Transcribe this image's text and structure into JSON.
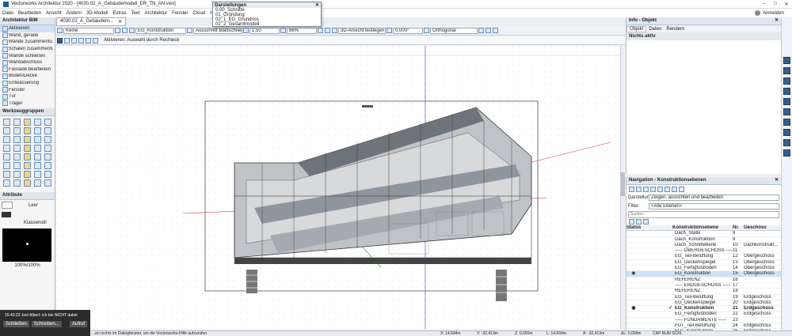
{
  "window": {
    "title": "Vectorworks Architektur 2020 - [4030.02_A_Gebäudemodell_ER_TN_AN.vwx]",
    "controls": [
      "–",
      "□",
      "✕"
    ],
    "login": "Anmelden"
  },
  "menu": [
    "Datei",
    "Bearbeiten",
    "Ansicht",
    "Ändern",
    "3D-Modell",
    "Extras",
    "Text",
    "Architektur",
    "Fenster",
    "Cloud",
    "Hilfe"
  ],
  "darstellungen": {
    "title": "Darstellungen",
    "items": [
      "0.00_Schnitte",
      "01_Gründung",
      "02_1_EG_Grundriss",
      "02_2_Gesamtmodell"
    ]
  },
  "doc_tab": "4030.02_A_Gebäudem...",
  "toolbar": {
    "class_select": "Keine",
    "layer_select": "EG_Konstruktion",
    "fill_select": "Ausschnitt Blattschneide...",
    "scale": "1:50",
    "zoom": "66%",
    "view_select": "3D-Ansicht festlegen",
    "angle": "0,000°",
    "projection": "Orthogonal"
  },
  "modebar": {
    "hint": "Aktivieren: Auswahl durch Rechteck"
  },
  "palette_arch": {
    "title": "Architektur BIM",
    "items": [
      "Aktivieren",
      "Wand, gerade",
      "Wände zusammenfü...",
      "Schalen zusammenfü...",
      "Wände schließen",
      "Wandabschluss",
      "Fassade bearbeiten",
      "Boden/Decke",
      "Entwässerung",
      "Fenster",
      "Tür",
      "Träger"
    ]
  },
  "palette_tools": {
    "title": "Werkzeuggruppen"
  },
  "palette_attr": {
    "title": "Attribute",
    "line_label": "Leer",
    "class_label": "Klassenstil",
    "preview_value": "100%/100%"
  },
  "info_palette": {
    "title": "Info - Objekt",
    "tabs": [
      "Objekt",
      "Daten",
      "Rendern"
    ],
    "status": "Nichts aktiv"
  },
  "navigation": {
    "title": "Navigation - Konstruktionsebenen",
    "display_label": "Darstellung:",
    "display_value": "Zeigen, ausrichten und bearbeiten",
    "filter_label": "Filter",
    "filter_value": "<Alle Ebenen>",
    "search_placeholder": "Suchen",
    "columns": [
      "Status",
      "",
      "Konstruktionsebene",
      "Nr.",
      "Geschoss"
    ],
    "rows": [
      {
        "name": "Dach_Statik",
        "nr": "9",
        "floor": "",
        "mark": "",
        "eye": false,
        "hl": false,
        "bold": false
      },
      {
        "name": "Dach_Konstruktion",
        "nr": "9",
        "floor": "",
        "mark": "",
        "eye": false,
        "hl": false,
        "bold": false
      },
      {
        "name": "Dach_Schnittebene",
        "nr": "10",
        "floor": "Dachkonstrukt...",
        "mark": "",
        "eye": false,
        "hl": false,
        "bold": false
      },
      {
        "name": "----- OBERGESCHOSS -----",
        "nr": "11",
        "floor": "",
        "mark": "",
        "eye": false,
        "hl": false,
        "bold": false
      },
      {
        "name": "EG_Teil-Belüftung",
        "nr": "12",
        "floor": "Obergeschoss",
        "mark": "",
        "eye": false,
        "hl": false,
        "bold": false
      },
      {
        "name": "EG_Deckenspiegel",
        "nr": "13",
        "floor": "Obergeschoss",
        "mark": "",
        "eye": false,
        "hl": false,
        "bold": false
      },
      {
        "name": "EG_Fertigfußboden",
        "nr": "14",
        "floor": "Obergeschoss",
        "mark": "",
        "eye": false,
        "hl": false,
        "bold": false
      },
      {
        "name": "EG_Konstruktion",
        "nr": "15",
        "floor": "Obergeschoss",
        "mark": "",
        "eye": true,
        "hl": true,
        "bold": false
      },
      {
        "name": "REFERENZ",
        "nr": "16",
        "floor": "",
        "mark": "",
        "eye": false,
        "hl": false,
        "bold": false
      },
      {
        "name": "----- ERDGESCHOSS -----",
        "nr": "17",
        "floor": "",
        "mark": "",
        "eye": false,
        "hl": false,
        "bold": false
      },
      {
        "name": "REFERENZ",
        "nr": "18",
        "floor": "",
        "mark": "",
        "eye": false,
        "hl": false,
        "bold": false
      },
      {
        "name": "EG_Teil-Belüftung",
        "nr": "19",
        "floor": "Erdgeschoss",
        "mark": "",
        "eye": false,
        "hl": false,
        "bold": false
      },
      {
        "name": "EG_Deckenspiegel",
        "nr": "20",
        "floor": "Erdgeschoss",
        "mark": "",
        "eye": false,
        "hl": false,
        "bold": false
      },
      {
        "name": "EG_Konstruktion",
        "nr": "21",
        "floor": "Erdgeschoss",
        "mark": "✓",
        "eye": true,
        "hl": false,
        "bold": true
      },
      {
        "name": "EG_Fertigfußboden",
        "nr": "22",
        "floor": "Erdgeschoss",
        "mark": "",
        "eye": false,
        "hl": false,
        "bold": false
      },
      {
        "name": "----- FUNDAMENTE -----",
        "nr": "23",
        "floor": "",
        "mark": "",
        "eye": false,
        "hl": false,
        "bold": false
      },
      {
        "name": "FUT_Teil-Belüftung",
        "nr": "24",
        "floor": "Erdgeschoss",
        "mark": "",
        "eye": false,
        "hl": false,
        "bold": false
      },
      {
        "name": "FUT_Konstruktion",
        "nr": "25",
        "floor": "Erdgeschoss",
        "mark": "",
        "eye": false,
        "hl": false,
        "bold": false
      }
    ]
  },
  "notification": {
    "text": "15:43:23 Joel Albert: ich bin NICHT dabei",
    "buttons": [
      "Schließen",
      "Schreiben...",
      "Aufruf"
    ]
  },
  "statusbar": {
    "hint": "...en rechts im Dialogfenster, um die Vectorworks-Hilfe aufzurufen.",
    "x": "X: 14,694m",
    "y": "Y: -32,413m",
    "z": "Z: 0,000m",
    "l": "L: 14,694m",
    "a": "A: -32,413m",
    "dl": "ΔL: 0,000m",
    "flags": "CAP NUM SCRL"
  },
  "colors": {
    "accent": "#1e5a96",
    "canvas": "#ffffff",
    "highlight": "#cfe2f5"
  }
}
